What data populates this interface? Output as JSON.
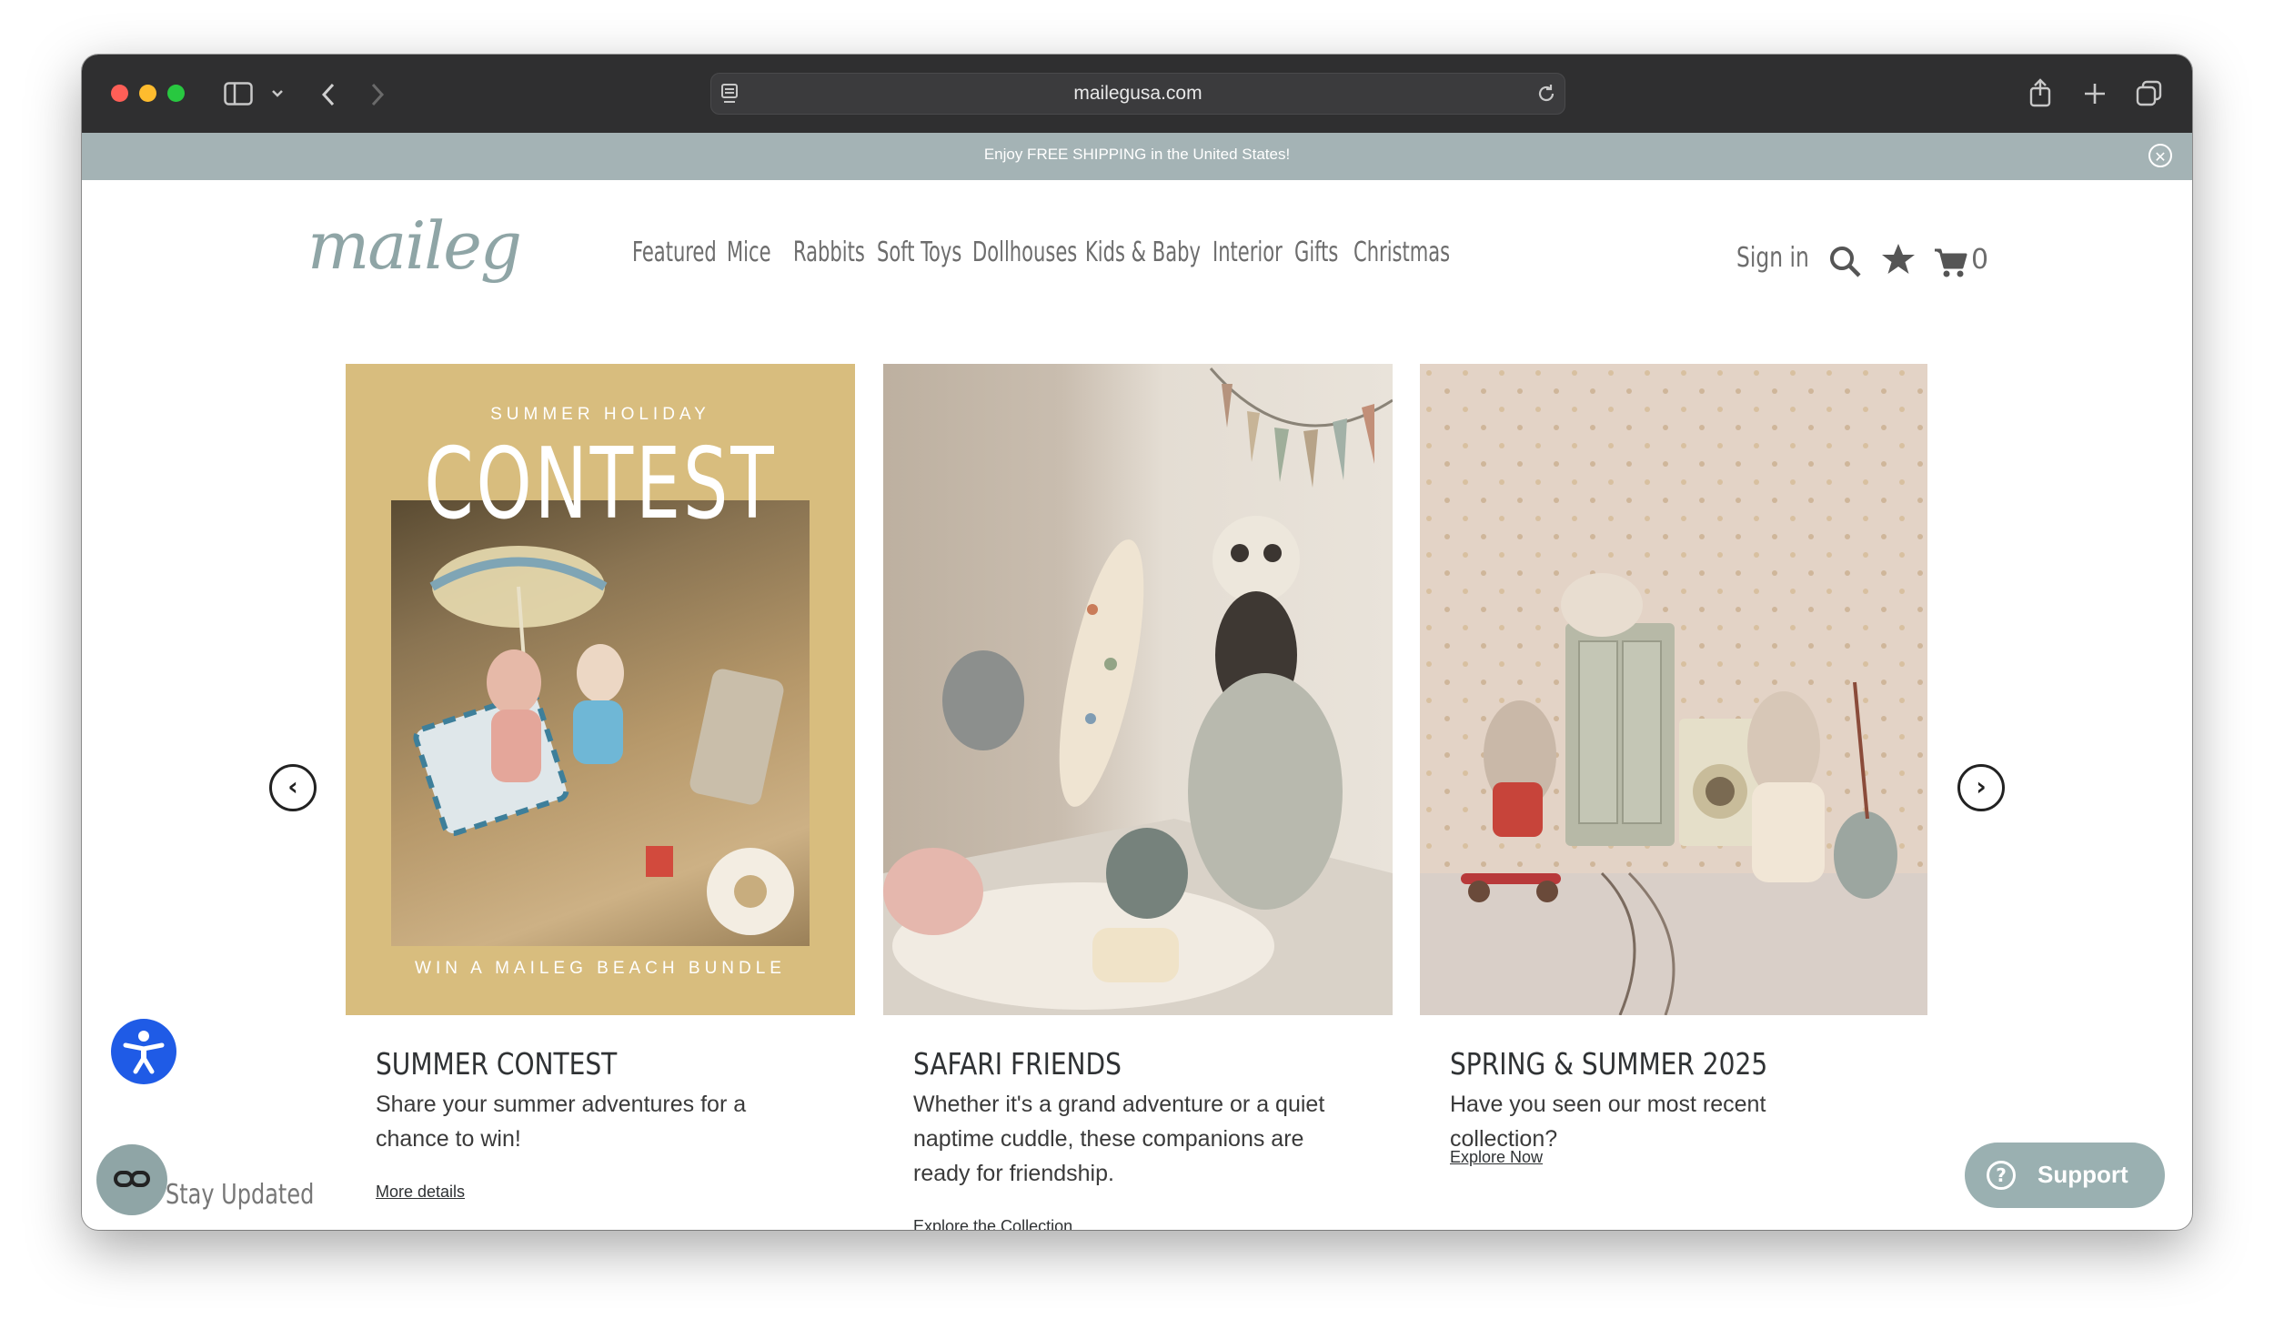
{
  "browser": {
    "url": "mailegusa.com"
  },
  "announcement": {
    "text": "Enjoy FREE SHIPPING in the United States!"
  },
  "header": {
    "logo": "maileg",
    "nav": [
      "Featured",
      "Mice",
      "Rabbits",
      "Soft Toys",
      "Dollhouses",
      "Kids & Baby",
      "Interior",
      "Gifts",
      "Christmas"
    ],
    "sign_in": "Sign in",
    "cart_count": "0"
  },
  "carousel": {
    "cards": [
      {
        "image_overline": "SUMMER HOLIDAY",
        "image_headline": "CONTEST",
        "image_footer": "WIN A MAILEG BEACH BUNDLE",
        "title": "SUMMER CONTEST",
        "description": "Share your summer adventures for a chance to win!",
        "link": "More details"
      },
      {
        "title": "SAFARI FRIENDS",
        "description": "Whether it's a grand adventure or a quiet naptime cuddle, these companions are ready for friendship.",
        "link": "Explore the Collection"
      },
      {
        "title": "SPRING & SUMMER 2025",
        "description": "Have you seen our most recent collection?",
        "link": "Explore Now"
      }
    ]
  },
  "widgets": {
    "stay_updated": "Stay Updated",
    "support": "Support"
  },
  "colors": {
    "brand_sage": "#8fa5a6",
    "announcement_bg": "#a4b3b5",
    "accessibility_blue": "#1f5be6",
    "contest_bg": "#d8bd7e"
  },
  "icons": [
    "sidebar-icon",
    "back-icon",
    "forward-icon",
    "reload-icon",
    "share-icon",
    "new-tab-icon",
    "tabs-icon",
    "close-icon",
    "search-icon",
    "star-icon",
    "cart-icon",
    "chevron-left-icon",
    "chevron-right-icon",
    "accessibility-icon",
    "glasses-icon",
    "help-icon"
  ]
}
